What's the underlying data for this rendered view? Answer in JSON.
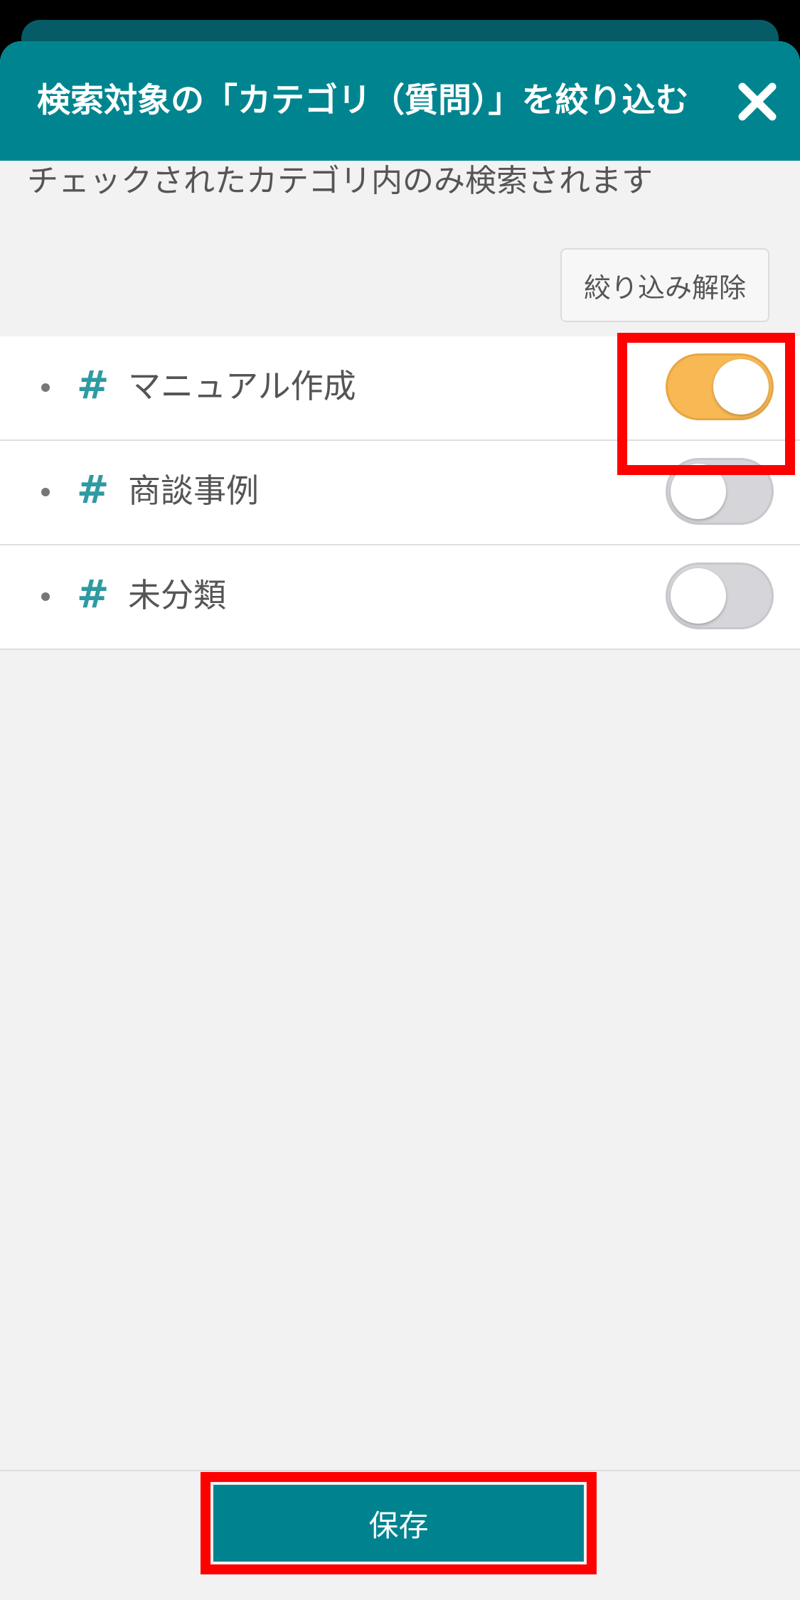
{
  "header": {
    "title": "検索対象の「カテゴリ（質問）」を絞り込む",
    "close_icon": "close-icon"
  },
  "description": "チェックされたカテゴリ内のみ検索されます",
  "clear_filter_label": "絞り込み解除",
  "categories": [
    {
      "label": "マニュアル作成",
      "enabled": true
    },
    {
      "label": "商談事例",
      "enabled": false
    },
    {
      "label": "未分類",
      "enabled": false
    }
  ],
  "hash_symbol": "#",
  "save_label": "保存",
  "colors": {
    "header": "#008590",
    "toggle_on": "#f8b854",
    "toggle_off": "#d5d5da",
    "hash_icon": "#2e9aa3",
    "highlight": "#ff0000",
    "save_button": "#00838f"
  }
}
